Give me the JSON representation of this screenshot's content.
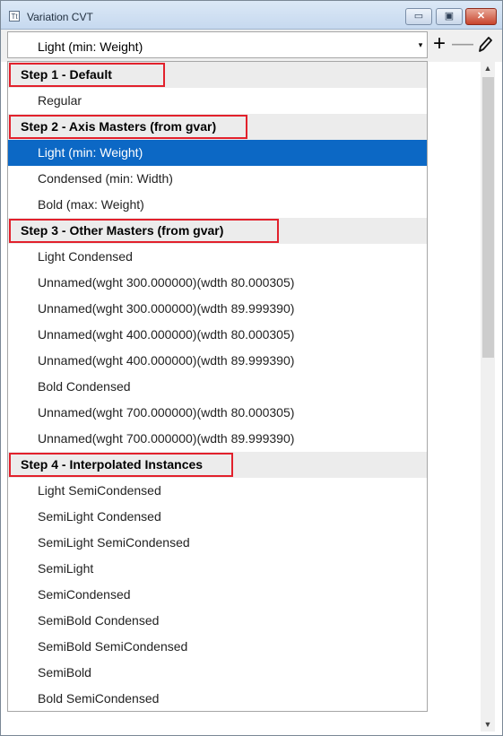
{
  "window": {
    "title": "Variation CVT",
    "app_icon": "Tt",
    "min_label": "▭",
    "max_label": "▣",
    "close_label": "✕"
  },
  "toolbar": {
    "selected_value": "Light (min: Weight)",
    "dropdown_icon": "▾",
    "add_label": "+",
    "remove_label": "—",
    "edit_icon": "pencil-icon"
  },
  "scrollbar": {
    "up_icon": "▲",
    "down_icon": "▼"
  },
  "list": [
    {
      "type": "header",
      "label": "Step 1 - Default"
    },
    {
      "type": "item",
      "label": "Regular"
    },
    {
      "type": "header",
      "label": "Step 2 - Axis Masters (from gvar)"
    },
    {
      "type": "item",
      "label": "Light (min: Weight)",
      "selected": true
    },
    {
      "type": "item",
      "label": "Condensed (min: Width)"
    },
    {
      "type": "item",
      "label": "Bold (max: Weight)"
    },
    {
      "type": "header",
      "label": "Step 3 - Other Masters (from gvar)"
    },
    {
      "type": "item",
      "label": "Light Condensed"
    },
    {
      "type": "item",
      "label": "Unnamed(wght 300.000000)(wdth 80.000305)"
    },
    {
      "type": "item",
      "label": "Unnamed(wght 300.000000)(wdth 89.999390)"
    },
    {
      "type": "item",
      "label": "Unnamed(wght 400.000000)(wdth 80.000305)"
    },
    {
      "type": "item",
      "label": "Unnamed(wght 400.000000)(wdth 89.999390)"
    },
    {
      "type": "item",
      "label": "Bold Condensed"
    },
    {
      "type": "item",
      "label": "Unnamed(wght 700.000000)(wdth 80.000305)"
    },
    {
      "type": "item",
      "label": "Unnamed(wght 700.000000)(wdth 89.999390)"
    },
    {
      "type": "header",
      "label": "Step 4 - Interpolated Instances"
    },
    {
      "type": "item",
      "label": "Light SemiCondensed"
    },
    {
      "type": "item",
      "label": "SemiLight Condensed"
    },
    {
      "type": "item",
      "label": "SemiLight SemiCondensed"
    },
    {
      "type": "item",
      "label": "SemiLight"
    },
    {
      "type": "item",
      "label": "SemiCondensed"
    },
    {
      "type": "item",
      "label": "SemiBold Condensed"
    },
    {
      "type": "item",
      "label": "SemiBold SemiCondensed"
    },
    {
      "type": "item",
      "label": "SemiBold"
    },
    {
      "type": "item",
      "label": "Bold SemiCondensed"
    }
  ]
}
